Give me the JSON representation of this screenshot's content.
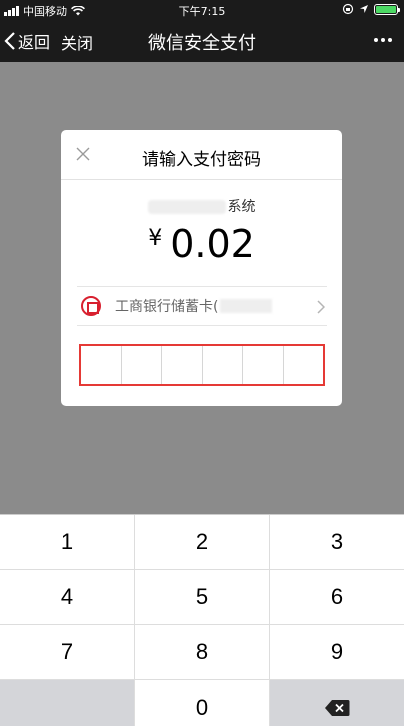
{
  "status_bar": {
    "carrier": "中国移动",
    "time": "下午7:15"
  },
  "nav": {
    "back_label": "返回",
    "close_label": "关闭",
    "title": "微信安全支付"
  },
  "dialog": {
    "title": "请输入支付密码",
    "merchant_suffix": "系统",
    "currency": "¥",
    "amount": "0.02",
    "payment_method": "工商银行储蓄卡(",
    "password_digits": 6
  },
  "keypad": {
    "rows": [
      [
        "1",
        "2",
        "3"
      ],
      [
        "4",
        "5",
        "6"
      ],
      [
        "7",
        "8",
        "9"
      ],
      [
        "",
        "0",
        "⌫"
      ]
    ]
  },
  "colors": {
    "accent_red": "#e53935",
    "battery_green": "#4cd964",
    "overlay": "#8b8b8b"
  }
}
